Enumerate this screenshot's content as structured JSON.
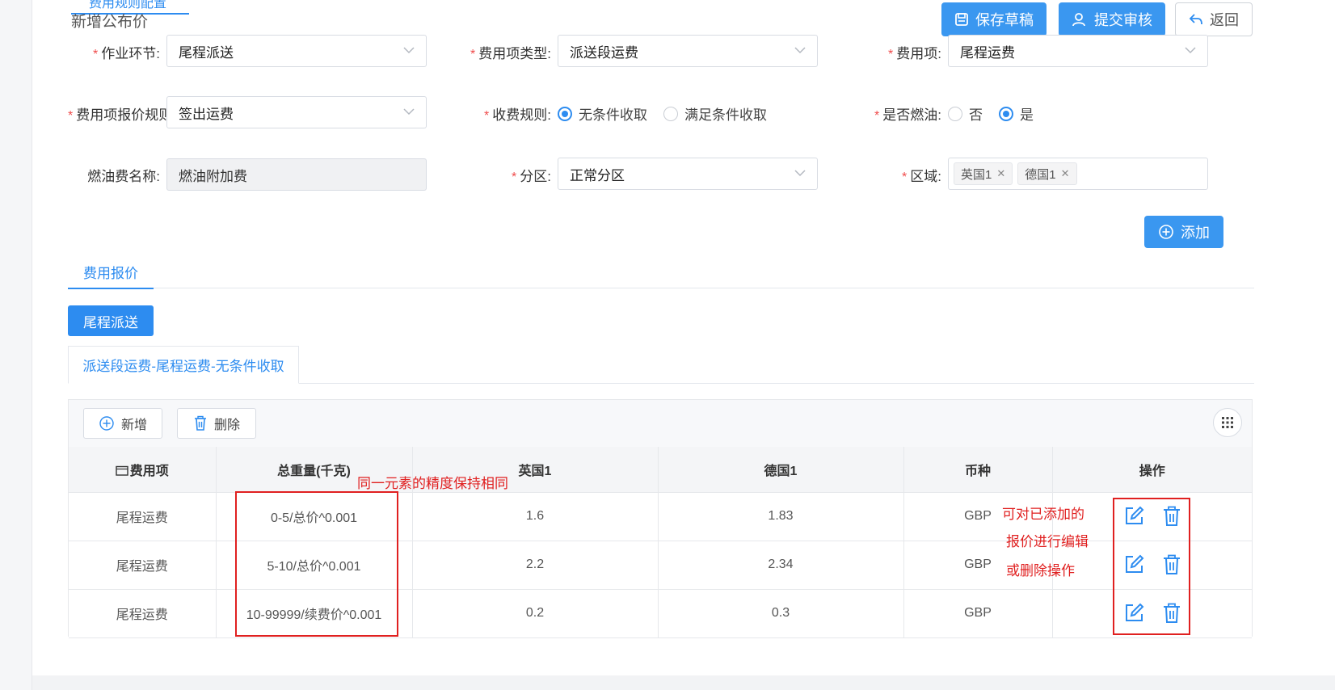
{
  "header": {
    "top_tab_label": "费用规则配置",
    "title": "新增公布价",
    "save_draft_label": "保存草稿",
    "submit_label": "提交审核",
    "back_label": "返回"
  },
  "form": {
    "operation_step": {
      "label": "作业环节:",
      "value": "尾程派送"
    },
    "fee_type": {
      "label": "费用项类型:",
      "value": "派送段运费"
    },
    "fee_item": {
      "label": "费用项:",
      "value": "尾程运费"
    },
    "quote_rule": {
      "label": "费用项报价规则",
      "value": "签出运费"
    },
    "charge_rule": {
      "label": "收费规则:",
      "options": [
        "无条件收取",
        "满足条件收取"
      ],
      "selected": 0
    },
    "fuel": {
      "label": "是否燃油:",
      "options": [
        "否",
        "是"
      ],
      "selected": 1
    },
    "fuel_name": {
      "label": "燃油费名称:",
      "value": "燃油附加费"
    },
    "partition": {
      "label": "分区:",
      "value": "正常分区"
    },
    "region": {
      "label": "区域:",
      "tags": [
        "英国1",
        "德国1"
      ]
    },
    "add_label": "添加"
  },
  "quote": {
    "tab_label": "费用报价",
    "step_pill": "尾程派送",
    "subtab_label": "派送段运费-尾程运费-无条件收取",
    "toolbar": {
      "add_label": "新增",
      "delete_label": "删除"
    },
    "columns": [
      "费用项",
      "总重量(千克)",
      "英国1",
      "德国1",
      "币种",
      "操作"
    ],
    "rows": [
      [
        "尾程运费",
        "0-5/总价^0.001",
        "1.6",
        "1.83",
        "GBP"
      ],
      [
        "尾程运费",
        "5-10/总价^0.001",
        "2.2",
        "2.34",
        "GBP"
      ],
      [
        "尾程运费",
        "10-99999/续费价^0.001",
        "0.2",
        "0.3",
        "GBP"
      ]
    ]
  },
  "annotations": {
    "precision_note": "同一元素的精度保持相同",
    "edit_note_1": "可对已添加的",
    "edit_note_2": "报价进行编辑",
    "edit_note_3": "或删除操作"
  },
  "colors": {
    "primary": "#2d8cf0",
    "required": "#f04b4b",
    "annotation": "#e02020"
  }
}
